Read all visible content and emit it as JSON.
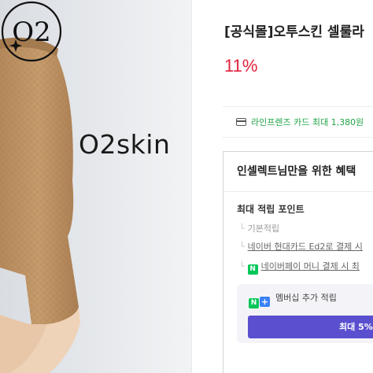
{
  "product": {
    "brand_logo_text": "O2skin",
    "logo_monogram": "O2",
    "title": "[공식몰]오투스킨 셀룰라",
    "discount": "11%"
  },
  "card_promo": {
    "icon": "credit-card-icon",
    "text": "라인프렌즈 카드 최대 1,380원"
  },
  "benefits": {
    "heading": "인셀렉트님만을 위한 혜택",
    "points_title": "최대 적립 포인트",
    "items": [
      {
        "label": "기본적립"
      },
      {
        "label": "네이버 현대카드 Ed2로 결제 시"
      },
      {
        "label": "네이버페이 머니 결제 시 최"
      }
    ],
    "npay_badge": "N",
    "membership": {
      "badge_n": "N",
      "badge_plus": "+",
      "label": "멤버십 추가 적립",
      "button_label": "최대 5%"
    }
  },
  "colors": {
    "discount_red": "#e0213b",
    "card_green": "#22a447",
    "membership_purple": "#5a4fcf",
    "naver_green": "#03c75a"
  }
}
